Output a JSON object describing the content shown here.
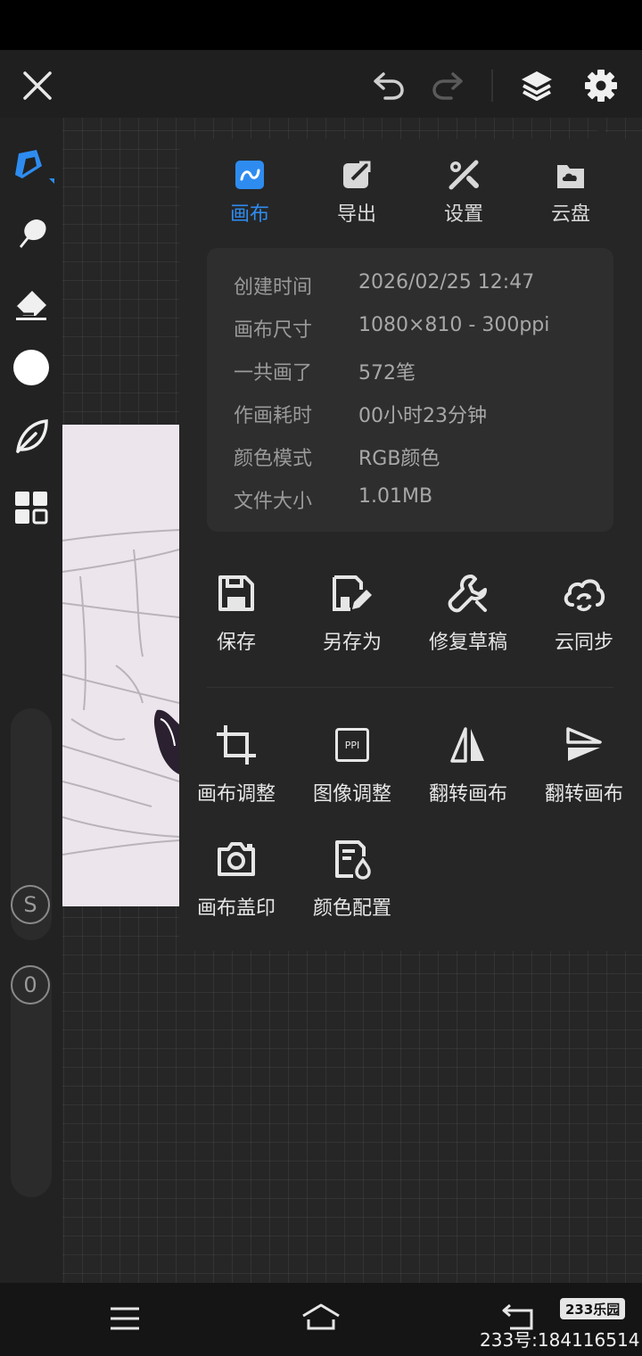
{
  "tabs": [
    {
      "label": "画布",
      "icon": "canvas-icon",
      "active": true
    },
    {
      "label": "导出",
      "icon": "export-icon",
      "active": false
    },
    {
      "label": "设置",
      "icon": "settings-tools-icon",
      "active": false
    },
    {
      "label": "云盘",
      "icon": "cloud-drive-icon",
      "active": false
    }
  ],
  "info": {
    "created": {
      "label": "创建时间",
      "value": "2026/02/25 12:47"
    },
    "size": {
      "label": "画布尺寸",
      "value": "1080×810 - 300ppi"
    },
    "strokes": {
      "label": "一共画了",
      "value": "572笔"
    },
    "duration": {
      "label": "作画耗时",
      "value": "00小时23分钟"
    },
    "color_mode": {
      "label": "颜色模式",
      "value": "RGB颜色"
    },
    "file_size": {
      "label": "文件大小",
      "value": "1.01MB"
    }
  },
  "actions": {
    "save": "保存",
    "save_as": "另存为",
    "repair": "修复草稿",
    "cloud_sync": "云同步",
    "canvas_adjust": "画布调整",
    "image_adjust": "图像调整",
    "flip_h": "翻转画布",
    "flip_v": "翻转画布",
    "stamp": "画布盖印",
    "color_config": "颜色配置",
    "ppi_badge": "PPI"
  },
  "sliders": {
    "stabilizer": "S",
    "opacity": "0"
  },
  "brand": {
    "badge": "233乐园",
    "watermark": "233号:184116514"
  },
  "colors": {
    "accent": "#2e8cf0",
    "panel": "#262626",
    "brush_color": "#ffffff"
  }
}
